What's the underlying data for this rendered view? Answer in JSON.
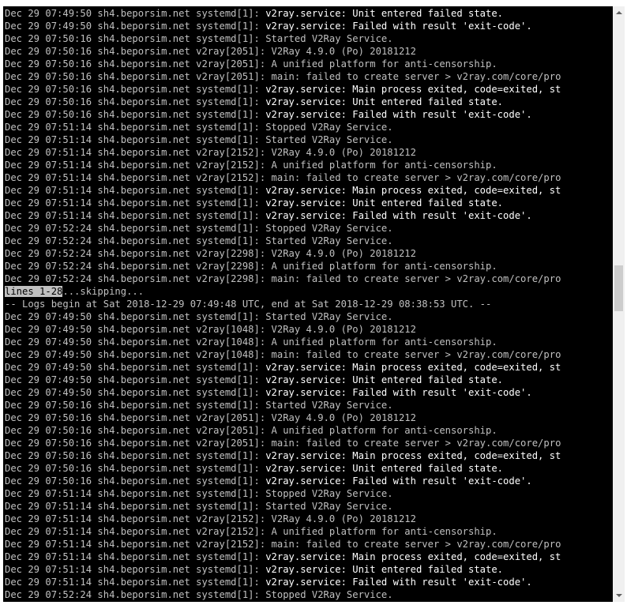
{
  "terminal": {
    "lines": [
      {
        "prefix": "Dec 29 07:49:50 sh4.beporsim.net systemd[1]: ",
        "msg": "v2ray.service: Unit entered failed state.",
        "bright": true
      },
      {
        "prefix": "Dec 29 07:49:50 sh4.beporsim.net systemd[1]: ",
        "msg": "v2ray.service: Failed with result 'exit-code'.",
        "bright": true
      },
      {
        "prefix": "Dec 29 07:50:16 sh4.beporsim.net systemd[1]: ",
        "msg": "Started V2Ray Service.",
        "bright": false
      },
      {
        "prefix": "Dec 29 07:50:16 sh4.beporsim.net v2ray[2051]: ",
        "msg": "V2Ray 4.9.0 (Po) 20181212",
        "bright": false
      },
      {
        "prefix": "Dec 29 07:50:16 sh4.beporsim.net v2ray[2051]: ",
        "msg": "A unified platform for anti-censorship.",
        "bright": false
      },
      {
        "prefix": "Dec 29 07:50:16 sh4.beporsim.net v2ray[2051]: ",
        "msg": "main: failed to create server > v2ray.com/core/pro",
        "bright": false
      },
      {
        "prefix": "Dec 29 07:50:16 sh4.beporsim.net systemd[1]: ",
        "msg": "v2ray.service: Main process exited, code=exited, st",
        "bright": true
      },
      {
        "prefix": "Dec 29 07:50:16 sh4.beporsim.net systemd[1]: ",
        "msg": "v2ray.service: Unit entered failed state.",
        "bright": true
      },
      {
        "prefix": "Dec 29 07:50:16 sh4.beporsim.net systemd[1]: ",
        "msg": "v2ray.service: Failed with result 'exit-code'.",
        "bright": true
      },
      {
        "prefix": "Dec 29 07:51:14 sh4.beporsim.net systemd[1]: ",
        "msg": "Stopped V2Ray Service.",
        "bright": false
      },
      {
        "prefix": "Dec 29 07:51:14 sh4.beporsim.net systemd[1]: ",
        "msg": "Started V2Ray Service.",
        "bright": false
      },
      {
        "prefix": "Dec 29 07:51:14 sh4.beporsim.net v2ray[2152]: ",
        "msg": "V2Ray 4.9.0 (Po) 20181212",
        "bright": false
      },
      {
        "prefix": "Dec 29 07:51:14 sh4.beporsim.net v2ray[2152]: ",
        "msg": "A unified platform for anti-censorship.",
        "bright": false
      },
      {
        "prefix": "Dec 29 07:51:14 sh4.beporsim.net v2ray[2152]: ",
        "msg": "main: failed to create server > v2ray.com/core/pro",
        "bright": false
      },
      {
        "prefix": "Dec 29 07:51:14 sh4.beporsim.net systemd[1]: ",
        "msg": "v2ray.service: Main process exited, code=exited, st",
        "bright": true
      },
      {
        "prefix": "Dec 29 07:51:14 sh4.beporsim.net systemd[1]: ",
        "msg": "v2ray.service: Unit entered failed state.",
        "bright": true
      },
      {
        "prefix": "Dec 29 07:51:14 sh4.beporsim.net systemd[1]: ",
        "msg": "v2ray.service: Failed with result 'exit-code'.",
        "bright": true
      },
      {
        "prefix": "Dec 29 07:52:24 sh4.beporsim.net systemd[1]: ",
        "msg": "Stopped V2Ray Service.",
        "bright": false
      },
      {
        "prefix": "Dec 29 07:52:24 sh4.beporsim.net systemd[1]: ",
        "msg": "Started V2Ray Service.",
        "bright": false
      },
      {
        "prefix": "Dec 29 07:52:24 sh4.beporsim.net v2ray[2298]: ",
        "msg": "V2Ray 4.9.0 (Po) 20181212",
        "bright": false
      },
      {
        "prefix": "Dec 29 07:52:24 sh4.beporsim.net v2ray[2298]: ",
        "msg": "A unified platform for anti-censorship.",
        "bright": false
      },
      {
        "prefix": "Dec 29 07:52:24 sh4.beporsim.net v2ray[2298]: ",
        "msg": "main: failed to create server > v2ray.com/core/pro",
        "bright": false
      },
      {
        "pager_status": "lines 1-28",
        "pager_rest": "...skipping..."
      },
      {
        "prefix": "-- Logs begin at Sat 2018-12-29 07:49:48 UTC, end at Sat 2018-12-29 08:38:53 UTC. --",
        "msg": "",
        "bright": false
      },
      {
        "prefix": "Dec 29 07:49:50 sh4.beporsim.net systemd[1]: ",
        "msg": "Started V2Ray Service.",
        "bright": false
      },
      {
        "prefix": "Dec 29 07:49:50 sh4.beporsim.net v2ray[1048]: ",
        "msg": "V2Ray 4.9.0 (Po) 20181212",
        "bright": false
      },
      {
        "prefix": "Dec 29 07:49:50 sh4.beporsim.net v2ray[1048]: ",
        "msg": "A unified platform for anti-censorship.",
        "bright": false
      },
      {
        "prefix": "Dec 29 07:49:50 sh4.beporsim.net v2ray[1048]: ",
        "msg": "main: failed to create server > v2ray.com/core/pro",
        "bright": false
      },
      {
        "prefix": "Dec 29 07:49:50 sh4.beporsim.net systemd[1]: ",
        "msg": "v2ray.service: Main process exited, code=exited, st",
        "bright": true
      },
      {
        "prefix": "Dec 29 07:49:50 sh4.beporsim.net systemd[1]: ",
        "msg": "v2ray.service: Unit entered failed state.",
        "bright": true
      },
      {
        "prefix": "Dec 29 07:49:50 sh4.beporsim.net systemd[1]: ",
        "msg": "v2ray.service: Failed with result 'exit-code'.",
        "bright": true
      },
      {
        "prefix": "Dec 29 07:50:16 sh4.beporsim.net systemd[1]: ",
        "msg": "Started V2Ray Service.",
        "bright": false
      },
      {
        "prefix": "Dec 29 07:50:16 sh4.beporsim.net v2ray[2051]: ",
        "msg": "V2Ray 4.9.0 (Po) 20181212",
        "bright": false
      },
      {
        "prefix": "Dec 29 07:50:16 sh4.beporsim.net v2ray[2051]: ",
        "msg": "A unified platform for anti-censorship.",
        "bright": false
      },
      {
        "prefix": "Dec 29 07:50:16 sh4.beporsim.net v2ray[2051]: ",
        "msg": "main: failed to create server > v2ray.com/core/pro",
        "bright": false
      },
      {
        "prefix": "Dec 29 07:50:16 sh4.beporsim.net systemd[1]: ",
        "msg": "v2ray.service: Main process exited, code=exited, st",
        "bright": true
      },
      {
        "prefix": "Dec 29 07:50:16 sh4.beporsim.net systemd[1]: ",
        "msg": "v2ray.service: Unit entered failed state.",
        "bright": true
      },
      {
        "prefix": "Dec 29 07:50:16 sh4.beporsim.net systemd[1]: ",
        "msg": "v2ray.service: Failed with result 'exit-code'.",
        "bright": true
      },
      {
        "prefix": "Dec 29 07:51:14 sh4.beporsim.net systemd[1]: ",
        "msg": "Stopped V2Ray Service.",
        "bright": false
      },
      {
        "prefix": "Dec 29 07:51:14 sh4.beporsim.net systemd[1]: ",
        "msg": "Started V2Ray Service.",
        "bright": false
      },
      {
        "prefix": "Dec 29 07:51:14 sh4.beporsim.net v2ray[2152]: ",
        "msg": "V2Ray 4.9.0 (Po) 20181212",
        "bright": false
      },
      {
        "prefix": "Dec 29 07:51:14 sh4.beporsim.net v2ray[2152]: ",
        "msg": "A unified platform for anti-censorship.",
        "bright": false
      },
      {
        "prefix": "Dec 29 07:51:14 sh4.beporsim.net v2ray[2152]: ",
        "msg": "main: failed to create server > v2ray.com/core/pro",
        "bright": false
      },
      {
        "prefix": "Dec 29 07:51:14 sh4.beporsim.net systemd[1]: ",
        "msg": "v2ray.service: Main process exited, code=exited, st",
        "bright": true
      },
      {
        "prefix": "Dec 29 07:51:14 sh4.beporsim.net systemd[1]: ",
        "msg": "v2ray.service: Unit entered failed state.",
        "bright": true
      },
      {
        "prefix": "Dec 29 07:51:14 sh4.beporsim.net systemd[1]: ",
        "msg": "v2ray.service: Failed with result 'exit-code'.",
        "bright": true
      },
      {
        "prefix": "Dec 29 07:52:24 sh4.beporsim.net systemd[1]: ",
        "msg": "Stopped V2Ray Service.",
        "bright": false
      }
    ]
  },
  "scrollbar": {
    "position_fraction": 0.47,
    "visible_fraction": 0.08
  },
  "colors": {
    "background": "#000000",
    "text": "#c0c0c0",
    "text_bright": "#ffffff",
    "pager_highlight": "#c0c0c0"
  },
  "icons": {
    "scroll_up": "up-arrow-icon",
    "scroll_down": "down-arrow-icon"
  }
}
